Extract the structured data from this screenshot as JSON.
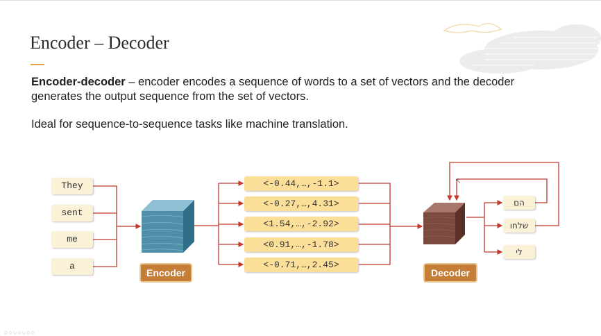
{
  "slide": {
    "title": "Encoder – Decoder",
    "desc_bold": "Encoder-decoder",
    "desc_rest": " – encoder encodes a sequence of words to a set of vectors and the decoder generates the output sequence from the set of vectors.",
    "ideal": "Ideal for sequence-to-sequence tasks like machine translation."
  },
  "diagram": {
    "input_words": [
      "They",
      "sent",
      "me",
      "a"
    ],
    "vectors": [
      "<-0.44,…,-1.1>",
      "<-0.27,…,4.31>",
      "<1.54,…,-2.92>",
      "<0.91,…,-1.78>",
      "<-0.71,…,2.45>"
    ],
    "outputs": [
      "הם",
      "שלחו",
      "לי"
    ],
    "encoder_label": "Encoder",
    "decoder_label": "Decoder"
  },
  "colors": {
    "accent": "#e3a33f",
    "arrow": "#c0392b",
    "encoder_cube": "#4f8fa8",
    "decoder_cube": "#7a4a3f",
    "label_fill": "#c47e38"
  }
}
